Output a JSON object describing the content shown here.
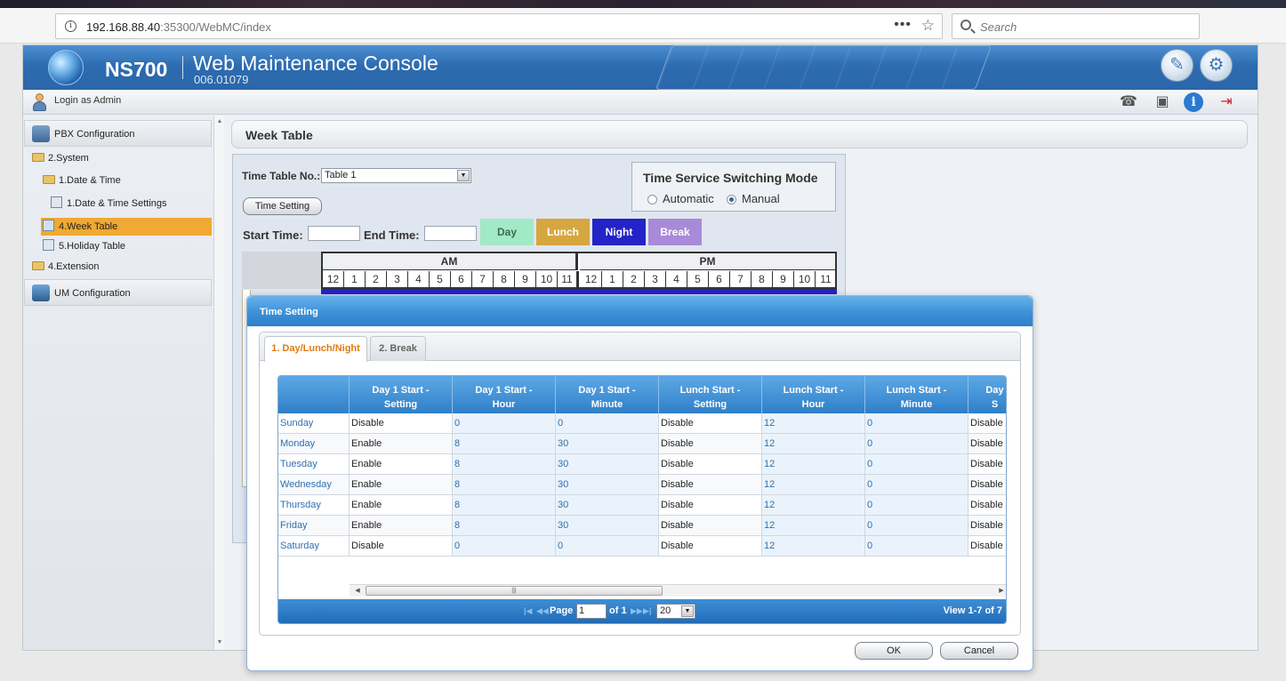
{
  "browser": {
    "url_host": "192.168.88.40",
    "url_rest": ":35300/WebMC/index",
    "search_placeholder": "Search"
  },
  "header": {
    "brand": "NS700",
    "title": "Web Maintenance Console",
    "version": "006.01079"
  },
  "loginbar": {
    "label": "Login as Admin"
  },
  "sidebar": {
    "section_pbx": "PBX Configuration",
    "items": [
      {
        "label": "2.System"
      },
      {
        "label": "1.Date & Time"
      },
      {
        "label": "1.Date & Time Settings"
      },
      {
        "label": "4.Week Table"
      },
      {
        "label": "5.Holiday Table"
      },
      {
        "label": "4.Extension"
      }
    ],
    "section_um": "UM Configuration"
  },
  "page": {
    "title": "Week Table"
  },
  "weektable": {
    "time_table_label": "Time Table No.:",
    "time_table_value": "Table 1",
    "time_setting_button": "Time Setting",
    "start_time_label": "Start Time:",
    "end_time_label": "End Time:",
    "legend": {
      "day": "Day",
      "lunch": "Lunch",
      "night": "Night",
      "break": "Break",
      "colors": {
        "day": "#a2e9c6",
        "lunch": "#d6a640",
        "night": "#2323c8",
        "break": "#a98ad8"
      }
    },
    "mode_title": "Time Service Switching Mode",
    "mode_automatic": "Automatic",
    "mode_manual": "Manual",
    "mode_selected": "Manual",
    "am_label": "AM",
    "pm_label": "PM",
    "hours": [
      "12",
      "1",
      "2",
      "3",
      "4",
      "5",
      "6",
      "7",
      "8",
      "9",
      "10",
      "11",
      "12",
      "1",
      "2",
      "3",
      "4",
      "5",
      "6",
      "7",
      "8",
      "9",
      "10",
      "11"
    ]
  },
  "modal": {
    "title": "Time Setting",
    "tabs": [
      "1. Day/Lunch/Night",
      "2. Break"
    ],
    "active_tab": "1. Day/Lunch/Night",
    "columns": [
      {
        "l1": "",
        "l2": ""
      },
      {
        "l1": "Day 1 Start -",
        "l2": "Setting"
      },
      {
        "l1": "Day 1 Start -",
        "l2": "Hour"
      },
      {
        "l1": "Day 1 Start -",
        "l2": "Minute"
      },
      {
        "l1": "Lunch Start -",
        "l2": "Setting"
      },
      {
        "l1": "Lunch Start -",
        "l2": "Hour"
      },
      {
        "l1": "Lunch Start -",
        "l2": "Minute"
      },
      {
        "l1": "Day",
        "l2": "S"
      }
    ],
    "rows": [
      [
        "Sunday",
        "Disable",
        "0",
        "0",
        "Disable",
        "12",
        "0",
        "Disable"
      ],
      [
        "Monday",
        "Enable",
        "8",
        "30",
        "Disable",
        "12",
        "0",
        "Disable"
      ],
      [
        "Tuesday",
        "Enable",
        "8",
        "30",
        "Disable",
        "12",
        "0",
        "Disable"
      ],
      [
        "Wednesday",
        "Enable",
        "8",
        "30",
        "Disable",
        "12",
        "0",
        "Disable"
      ],
      [
        "Thursday",
        "Enable",
        "8",
        "30",
        "Disable",
        "12",
        "0",
        "Disable"
      ],
      [
        "Friday",
        "Enable",
        "8",
        "30",
        "Disable",
        "12",
        "0",
        "Disable"
      ],
      [
        "Saturday",
        "Disable",
        "0",
        "0",
        "Disable",
        "12",
        "0",
        "Disable"
      ]
    ],
    "pager": {
      "page_label": "Page",
      "page_value": "1",
      "of_label": "of 1",
      "rows_per_page": "20",
      "view_text": "View 1-7 of 7"
    },
    "ok_label": "OK",
    "cancel_label": "Cancel"
  }
}
